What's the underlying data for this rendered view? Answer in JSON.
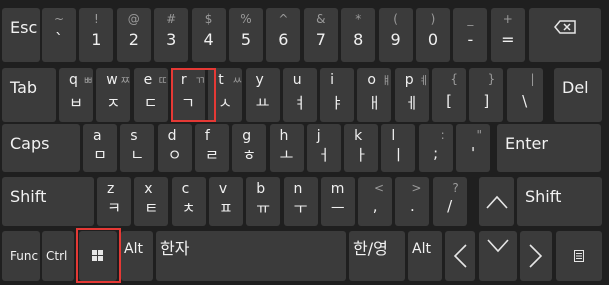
{
  "row1": {
    "esc": "Esc",
    "keys": [
      {
        "top": "~",
        "bot": "`"
      },
      {
        "top": "!",
        "bot": "1"
      },
      {
        "top": "@",
        "bot": "2"
      },
      {
        "top": "#",
        "bot": "3"
      },
      {
        "top": "$",
        "bot": "4"
      },
      {
        "top": "%",
        "bot": "5"
      },
      {
        "top": "^",
        "bot": "6"
      },
      {
        "top": "&",
        "bot": "7"
      },
      {
        "top": "*",
        "bot": "8"
      },
      {
        "top": "(",
        "bot": "9"
      },
      {
        "top": ")",
        "bot": "0"
      },
      {
        "top": "_",
        "bot": "-"
      },
      {
        "top": "+",
        "bot": "="
      }
    ],
    "backspace_icon": "backspace-icon"
  },
  "row2": {
    "tab": "Tab",
    "keys": [
      {
        "lat": "q",
        "sh": "ㅃ",
        "han": "ㅂ"
      },
      {
        "lat": "w",
        "sh": "ㅉ",
        "han": "ㅈ"
      },
      {
        "lat": "e",
        "sh": "ㄸ",
        "han": "ㄷ"
      },
      {
        "lat": "r",
        "sh": "ㄲ",
        "han": "ㄱ"
      },
      {
        "lat": "t",
        "sh": "ㅆ",
        "han": "ㅅ"
      },
      {
        "lat": "y",
        "sh": "",
        "han": "ㅛ"
      },
      {
        "lat": "u",
        "sh": "",
        "han": "ㅕ"
      },
      {
        "lat": "i",
        "sh": "",
        "han": "ㅑ"
      },
      {
        "lat": "o",
        "sh": "ㅒ",
        "han": "ㅐ"
      },
      {
        "lat": "p",
        "sh": "ㅖ",
        "han": "ㅔ"
      }
    ],
    "brackets": [
      {
        "top": "{",
        "bot": "["
      },
      {
        "top": "}",
        "bot": "]"
      },
      {
        "top": "|",
        "bot": "\\"
      }
    ],
    "del": "Del"
  },
  "row3": {
    "caps": "Caps",
    "keys": [
      {
        "lat": "a",
        "han": "ㅁ"
      },
      {
        "lat": "s",
        "han": "ㄴ"
      },
      {
        "lat": "d",
        "han": "ㅇ"
      },
      {
        "lat": "f",
        "han": "ㄹ"
      },
      {
        "lat": "g",
        "han": "ㅎ"
      },
      {
        "lat": "h",
        "han": "ㅗ"
      },
      {
        "lat": "j",
        "han": "ㅓ"
      },
      {
        "lat": "k",
        "han": "ㅏ"
      },
      {
        "lat": "l",
        "han": "ㅣ"
      }
    ],
    "punct": [
      {
        "top": ":",
        "bot": ";"
      },
      {
        "top": "\"",
        "bot": "'"
      }
    ],
    "enter": "Enter"
  },
  "row4": {
    "shift_l": "Shift",
    "keys": [
      {
        "lat": "z",
        "han": "ㅋ"
      },
      {
        "lat": "x",
        "han": "ㅌ"
      },
      {
        "lat": "c",
        "han": "ㅊ"
      },
      {
        "lat": "v",
        "han": "ㅍ"
      },
      {
        "lat": "b",
        "han": "ㅠ"
      },
      {
        "lat": "n",
        "han": "ㅜ"
      },
      {
        "lat": "m",
        "han": "ㅡ"
      }
    ],
    "punct": [
      {
        "top": "<",
        "bot": ","
      },
      {
        "top": ">",
        "bot": "."
      },
      {
        "top": "?",
        "bot": "/"
      }
    ],
    "up_icon": "arrow-up-icon",
    "shift_r": "Shift"
  },
  "row5": {
    "func": "Func",
    "ctrl": "Ctrl",
    "win_icon": "windows-icon",
    "alt_l": "Alt",
    "hanja": "한자",
    "hanyeong": "한/영",
    "alt_r": "Alt",
    "left_icon": "arrow-left-icon",
    "down_icon": "arrow-down-icon",
    "right_icon": "arrow-right-icon",
    "menu_icon": "menu-icon"
  },
  "highlight_color": "#e53935"
}
